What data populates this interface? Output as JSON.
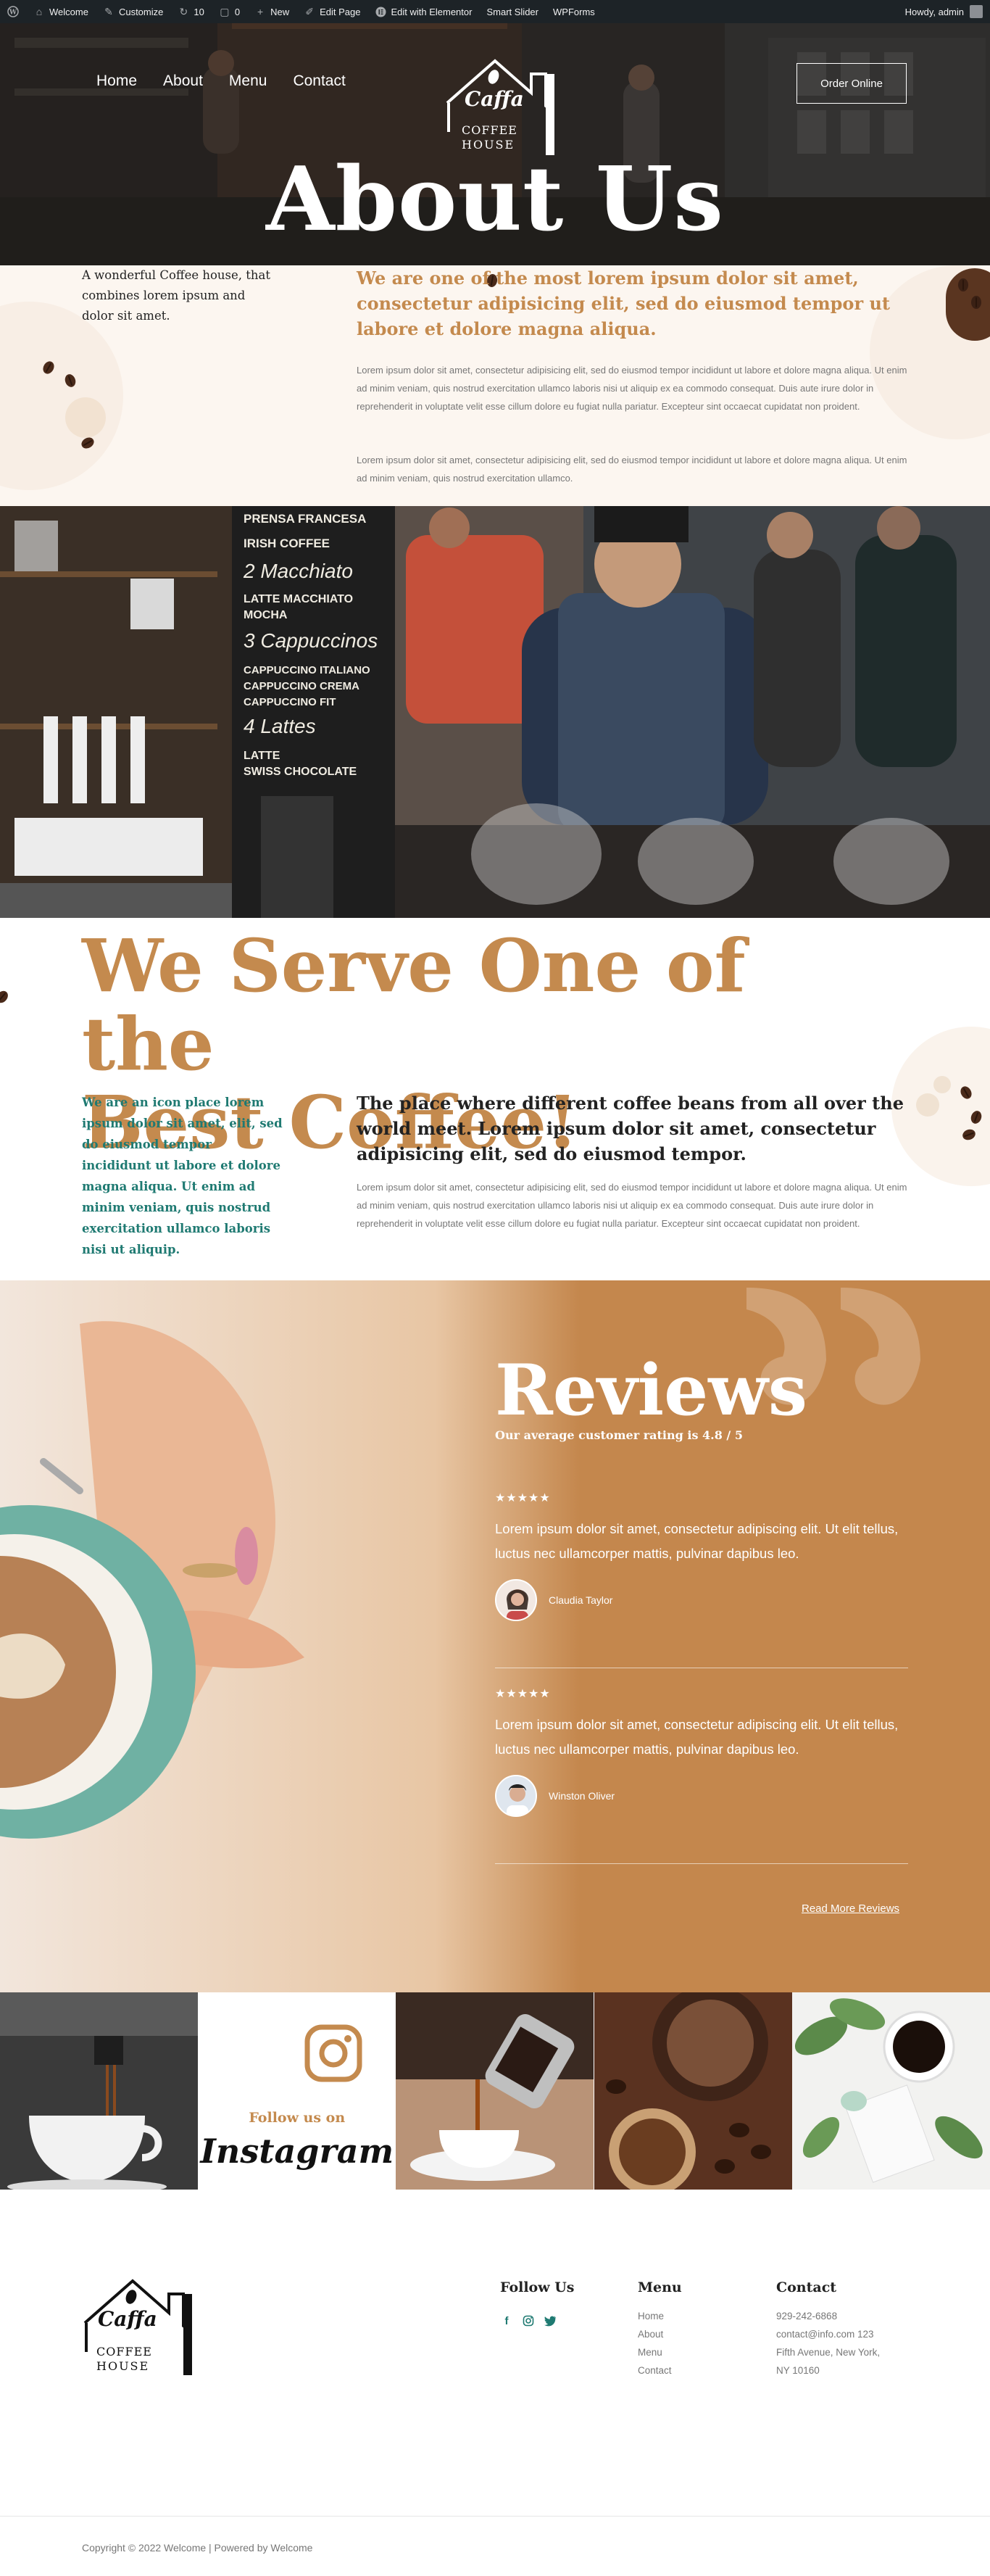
{
  "admin_bar": {
    "items": [
      {
        "icon": "wordpress-icon",
        "label": ""
      },
      {
        "icon": "home-icon",
        "label": "Welcome"
      },
      {
        "icon": "brush-icon",
        "label": "Customize"
      },
      {
        "icon": "updates-icon",
        "label": "10"
      },
      {
        "icon": "comment-icon",
        "label": "0"
      },
      {
        "icon": "plus-icon",
        "label": "New"
      },
      {
        "icon": "pencil-icon",
        "label": "Edit Page"
      },
      {
        "icon": "elementor-icon",
        "label": "Edit with Elementor"
      },
      {
        "icon": "",
        "label": "Smart Slider"
      },
      {
        "icon": "",
        "label": "WPForms"
      }
    ],
    "greeting": "Howdy, admin"
  },
  "header": {
    "nav": [
      "Home",
      "About",
      "Menu",
      "Contact"
    ],
    "logo": {
      "script": "Caffa",
      "line1": "COFFEE",
      "line2": "HOUSE"
    },
    "order_button": "Order Online",
    "page_title": "About Us"
  },
  "intro": {
    "left_text": "A wonderful Coffee house, that combines lorem ipsum and dolor sit amet.",
    "heading": "We are one of the most lorem ipsum dolor sit amet, consectetur adipisicing elit, sed do eiusmod tempor ut labore et dolore magna aliqua.",
    "paragraph1": "Lorem ipsum dolor sit amet, consectetur adipisicing elit, sed do eiusmod tempor incididunt ut labore et dolore magna aliqua. Ut enim ad minim veniam, quis nostrud exercitation ullamco laboris nisi ut aliquip ex ea commodo consequat. Duis aute irure dolor in reprehenderit in voluptate velit esse cillum dolore eu fugiat nulla pariatur. Excepteur sint occaecat cupidatat non proident.",
    "paragraph2": "Lorem ipsum dolor sit amet, consectetur adipisicing elit, sed do eiusmod tempor incididunt ut labore et dolore magna aliqua. Ut enim ad minim veniam, quis nostrud exercitation ullamco."
  },
  "menu_board": [
    "PRENSA FRANCESA",
    "IRISH COFFEE",
    "2 Macchiato",
    "LATTE MACCHIATO",
    "MOCHA",
    "3 Cappuccinos",
    "CAPPUCCINO ITALIANO",
    "CAPPUCCINO CREMA",
    "CAPPUCCINO FIT",
    "4 Lattes",
    "LATTE",
    "SWISS CHOCOLATE"
  ],
  "serve": {
    "title_line1": "We Serve One of the",
    "title_line2": "Best Coffee!",
    "left_text": "We are an icon place lorem ipsum dolor sit amet, elit, sed do eiusmod tempor incididunt ut labore et dolore magna aliqua. Ut enim ad minim veniam, quis nostrud exercitation ullamco laboris nisi ut aliquip.",
    "heading": "The place where different coffee beans from all over the world meet. Lorem ipsum dolor sit amet, consectetur adipisicing elit, sed do eiusmod tempor.",
    "paragraph": "Lorem ipsum dolor sit amet, consectetur adipisicing elit, sed do eiusmod tempor incididunt ut labore et dolore magna aliqua. Ut enim ad minim veniam, quis nostrud exercitation ullamco laboris nisi ut aliquip ex ea commodo consequat. Duis aute irure dolor in reprehenderit in voluptate velit esse cillum dolore eu fugiat nulla pariatur. Excepteur sint occaecat cupidatat non proident."
  },
  "reviews": {
    "title": "Reviews",
    "subtitle": "Our average customer rating is 4.8 / 5",
    "items": [
      {
        "stars": "★★★★★",
        "rating": 5,
        "text": "Lorem ipsum dolor sit amet, consectetur adipiscing elit. Ut elit tellus, luctus nec ullamcorper mattis, pulvinar dapibus leo.",
        "author": "Claudia Taylor"
      },
      {
        "stars": "★★★★★",
        "rating": 5,
        "text": "Lorem ipsum dolor sit amet, consectetur adipiscing elit. Ut elit tellus, luctus nec ullamcorper mattis, pulvinar dapibus leo.",
        "author": "Winston Oliver"
      }
    ],
    "read_more": "Read More Reviews"
  },
  "instagram": {
    "follow_label": "Follow us on",
    "word": "Instagram"
  },
  "footer": {
    "logo": {
      "script": "Caffa",
      "line1": "COFFEE",
      "line2": "HOUSE"
    },
    "follow_title": "Follow Us",
    "social": [
      "facebook-icon",
      "instagram-icon",
      "twitter-icon"
    ],
    "menu_title": "Menu",
    "menu_items": [
      "Home",
      "About",
      "Menu",
      "Contact"
    ],
    "contact_title": "Contact",
    "contact_lines": [
      "929-242-6868",
      "contact@info.com 123",
      "Fifth Avenue, New York,",
      "NY 10160"
    ],
    "copyright": "Copyright © 2022 Welcome | Powered by Welcome"
  },
  "colors": {
    "accent": "#c48a4e",
    "teal": "#1f7a72",
    "admin_bar": "#1d2327",
    "intro_bg": "#fcf6f0"
  }
}
